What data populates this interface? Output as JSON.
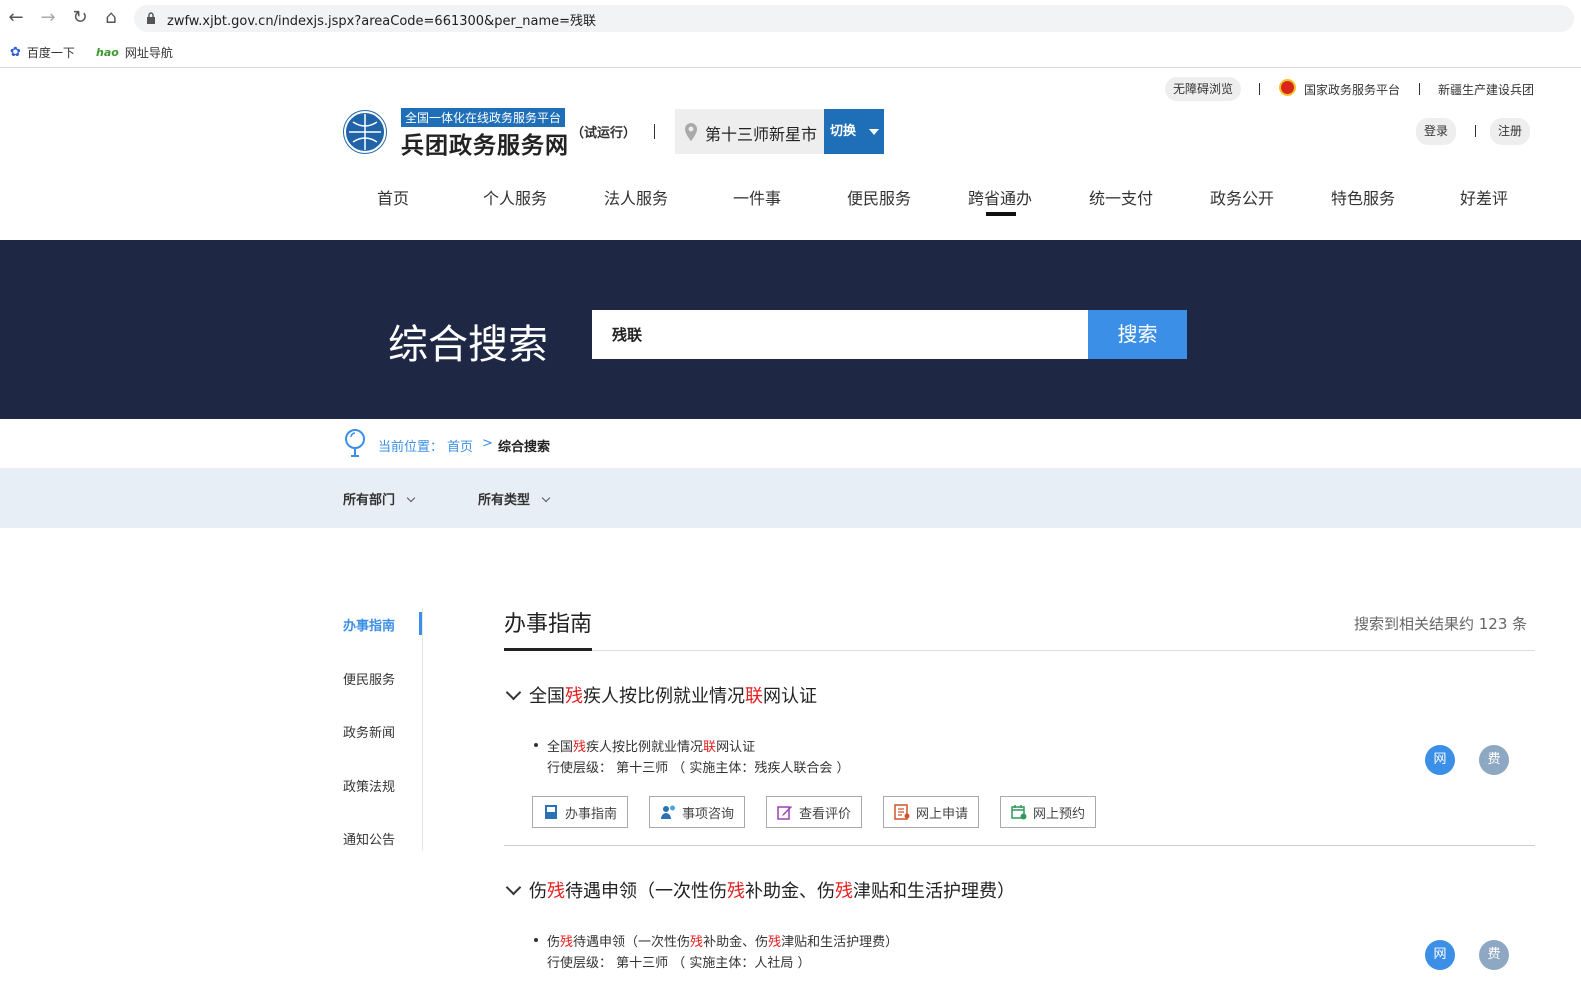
{
  "browser": {
    "url": "zwfw.xjbt.gov.cn/indexjs.jspx?areaCode=661300&per_name=残联",
    "bookmarks": [
      "百度一下",
      "网址导航"
    ]
  },
  "topbar": {
    "accessible": "无障碍浏览",
    "national_platform": "国家政务服务平台",
    "corps": "新疆生产建设兵团",
    "login": "登录",
    "register": "注册"
  },
  "logo": {
    "tagline": "全国一体化在线政务服务平台",
    "name": "兵团政务服务网",
    "trial": "（试运行）"
  },
  "location": {
    "name": "第十三师新星市",
    "switch": "切换"
  },
  "nav": [
    "首页",
    "个人服务",
    "法人服务",
    "一件事",
    "便民服务",
    "跨省通办",
    "统一支付",
    "政务公开",
    "特色服务",
    "好差评"
  ],
  "banner": {
    "title": "综合搜索",
    "query": "残联",
    "search_btn": "搜索"
  },
  "breadcrumb": {
    "prefix": "当前位置：",
    "home": "首页",
    "sep": ">",
    "current": "综合搜索"
  },
  "filters": [
    "所有部门",
    "所有类型"
  ],
  "sidebar": [
    "办事指南",
    "便民服务",
    "政务新闻",
    "政策法规",
    "通知公告"
  ],
  "section": {
    "title": "办事指南",
    "count_text": "搜索到相关结果约 123 条"
  },
  "results": [
    {
      "title_parts": [
        "全国",
        "残",
        "疾人按比例就业情况",
        "联",
        "网认证"
      ],
      "sub_parts": [
        "全国",
        "残",
        "疾人按比例就业情况",
        "联",
        "网认证"
      ],
      "level": "行使层级： 第十三师 （ 实施主体：残疾人联合会 ）",
      "buttons": [
        "办事指南",
        "事项咨询",
        "查看评价",
        "网上申请",
        "网上预约"
      ],
      "badges": [
        "网",
        "费"
      ]
    },
    {
      "title_parts": [
        "伤",
        "残",
        "待遇申领（一次性伤",
        "残",
        "补助金、伤",
        "残",
        "津贴和生活护理费）"
      ],
      "sub_parts": [
        "伤",
        "残",
        "待遇申领（一次性伤",
        "残",
        "补助金、伤",
        "残",
        "津贴和生活护理费）"
      ],
      "level": "行使层级： 第十三师 （ 实施主体：人社局 ）",
      "badges": [
        "网",
        "费"
      ]
    }
  ],
  "colors": {
    "banner": "#1e2844",
    "accent": "#3c8fe6",
    "highlight": "#e41e1e",
    "brand": "#1f6fb8"
  }
}
